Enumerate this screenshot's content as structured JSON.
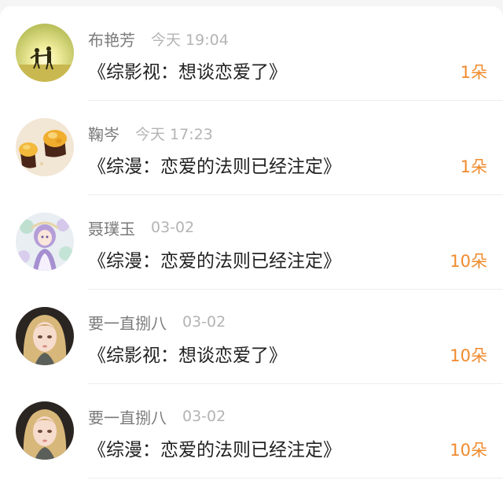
{
  "gifts": [
    {
      "user": "布艳芳",
      "time": "今天 19:04",
      "title": "《综影视：想谈恋爱了》",
      "count": "1朵",
      "avatar_icon": "couple-sunset-avatar"
    },
    {
      "user": "鞠岑",
      "time": "今天 17:23",
      "title": "《综漫：恋爱的法则已经注定》",
      "count": "1朵",
      "avatar_icon": "cupcake-avatar"
    },
    {
      "user": "聂璞玉",
      "time": "03-02",
      "title": "《综漫：恋爱的法则已经注定》",
      "count": "10朵",
      "avatar_icon": "anime-girl-avatar"
    },
    {
      "user": "要一直捌八",
      "time": "03-02",
      "title": "《综影视：想谈恋爱了》",
      "count": "10朵",
      "avatar_icon": "illustrated-girl-avatar"
    },
    {
      "user": "要一直捌八",
      "time": "03-02",
      "title": "《综漫：恋爱的法则已经注定》",
      "count": "10朵",
      "avatar_icon": "illustrated-girl-avatar"
    }
  ],
  "colors": {
    "count": "#f08a2c",
    "title": "#222222",
    "name": "#7a7a7a",
    "time": "#b4b4b4"
  }
}
